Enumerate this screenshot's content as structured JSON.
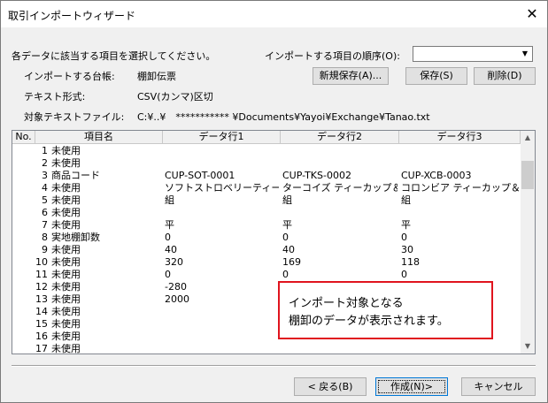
{
  "window": {
    "title": "取引インポートウィザード",
    "close_icon": "✕"
  },
  "header": {
    "instruction": "各データに該当する項目を選択してください。",
    "order_label": "インポートする項目の順序(O):",
    "order_value": "",
    "ledger_label": "インポートする台帳:",
    "ledger_value": "棚卸伝票",
    "format_label": "テキスト形式:",
    "format_value": "CSV(カンマ)区切",
    "file_label": "対象テキストファイル:",
    "file_value": "C:¥..¥　*********** ¥Documents¥Yayoi¥Exchange¥Tanao.txt",
    "new_save_button": "新規保存(A)...",
    "save_button": "保存(S)",
    "delete_button": "削除(D)"
  },
  "grid": {
    "columns": [
      "No.",
      "項目名",
      "データ行1",
      "データ行2",
      "データ行3"
    ],
    "rows": [
      {
        "no": "1",
        "name": "未使用",
        "d1": "",
        "d2": "",
        "d3": ""
      },
      {
        "no": "2",
        "name": "未使用",
        "d1": "",
        "d2": "",
        "d3": ""
      },
      {
        "no": "3",
        "name": "商品コード",
        "d1": "CUP-SOT-0001",
        "d2": "CUP-TKS-0002",
        "d3": "CUP-XCB-0003"
      },
      {
        "no": "4",
        "name": "未使用",
        "d1": "ソフトストロベリーティーカッ…",
        "d2": "ターコイズ ティーカップ＆ソ…",
        "d3": "コロンビア ティーカップ＆ソー…"
      },
      {
        "no": "5",
        "name": "未使用",
        "d1": "組",
        "d2": "組",
        "d3": "組"
      },
      {
        "no": "6",
        "name": "未使用",
        "d1": "",
        "d2": "",
        "d3": ""
      },
      {
        "no": "7",
        "name": "未使用",
        "d1": "平",
        "d2": "平",
        "d3": "平"
      },
      {
        "no": "8",
        "name": "実地棚卸数",
        "d1": "0",
        "d2": "0",
        "d3": "0"
      },
      {
        "no": "9",
        "name": "未使用",
        "d1": "40",
        "d2": "40",
        "d3": "30"
      },
      {
        "no": "10",
        "name": "未使用",
        "d1": "320",
        "d2": "169",
        "d3": "118"
      },
      {
        "no": "11",
        "name": "未使用",
        "d1": "0",
        "d2": "0",
        "d3": "0"
      },
      {
        "no": "12",
        "name": "未使用",
        "d1": "-280",
        "d2": "",
        "d3": ""
      },
      {
        "no": "13",
        "name": "未使用",
        "d1": "2000",
        "d2": "",
        "d3": ""
      },
      {
        "no": "14",
        "name": "未使用",
        "d1": "",
        "d2": "",
        "d3": ""
      },
      {
        "no": "15",
        "name": "未使用",
        "d1": "",
        "d2": "",
        "d3": ""
      },
      {
        "no": "16",
        "name": "未使用",
        "d1": "",
        "d2": "",
        "d3": ""
      },
      {
        "no": "17",
        "name": "未使用",
        "d1": "",
        "d2": "",
        "d3": ""
      }
    ]
  },
  "callout": {
    "line1": "インポート対象となる",
    "line2": "棚卸のデータが表示されます。"
  },
  "footer": {
    "back_button": "< 戻る(B)",
    "next_button": "作成(N)>",
    "cancel_button": "キャンセル"
  },
  "icons": {
    "dropdown": "chevron-down-icon",
    "scroll_up": "triangle-up-icon",
    "scroll_down": "triangle-down-icon"
  },
  "colors": {
    "callout_border": "#e0141e",
    "focus_border": "#0078d7"
  }
}
